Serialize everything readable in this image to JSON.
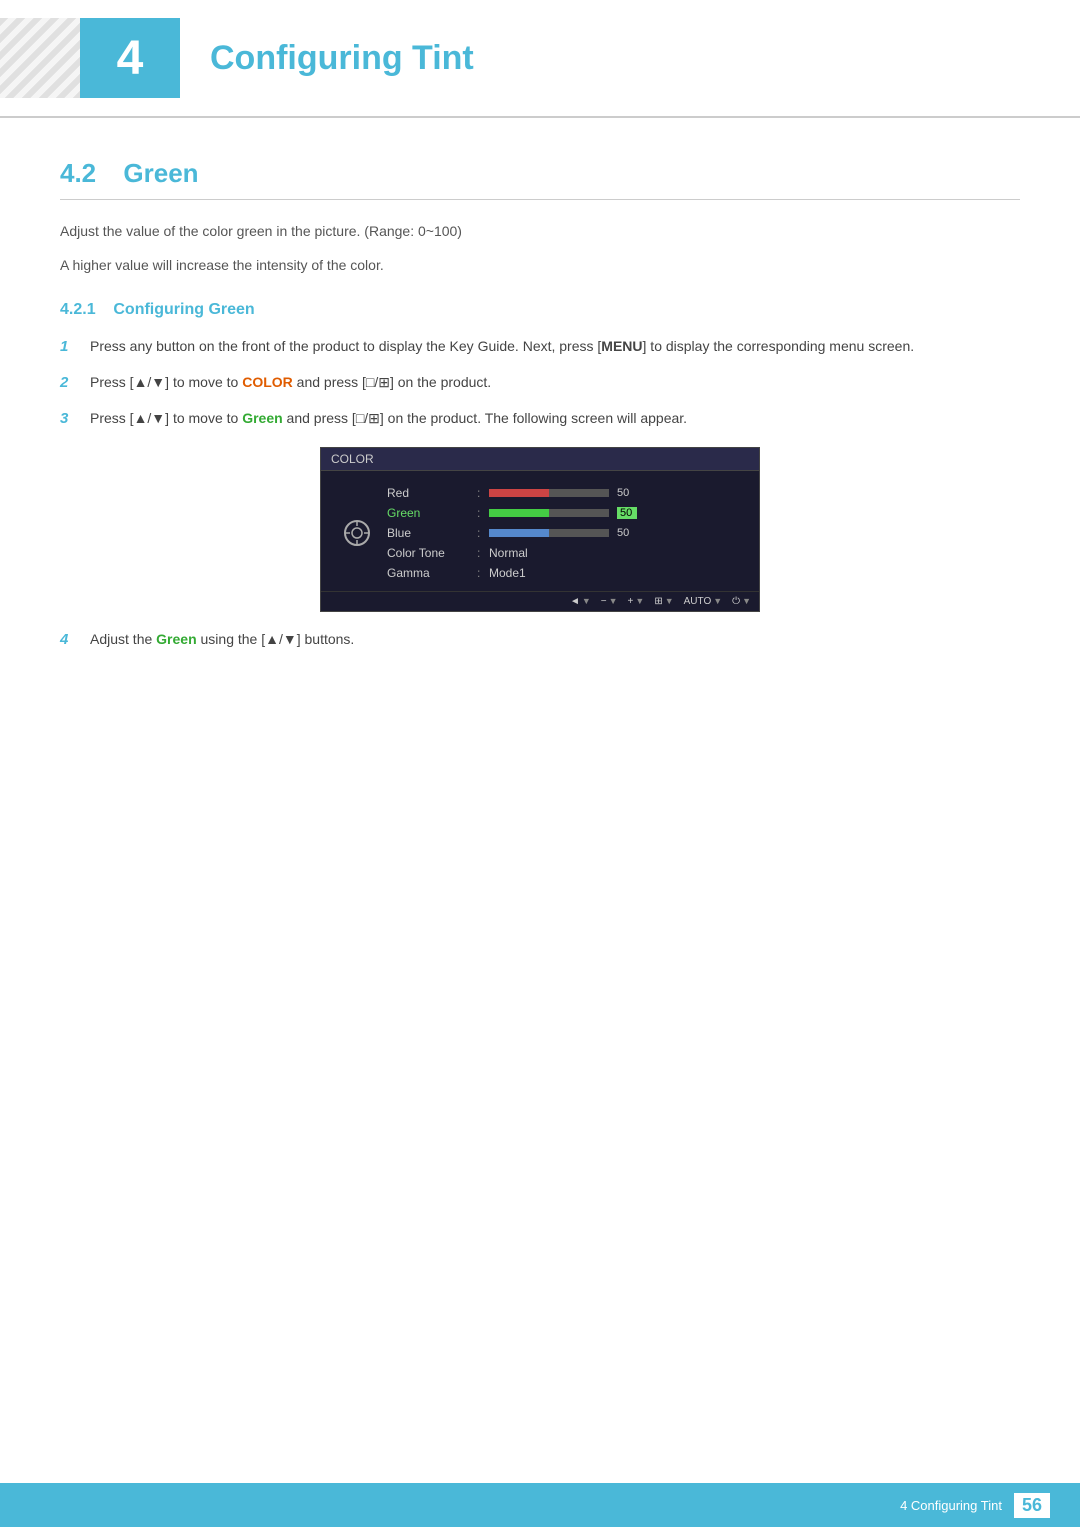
{
  "chapter": {
    "number": "4",
    "title": "Configuring Tint"
  },
  "section42": {
    "heading": "4.2",
    "title": "Green",
    "desc1": "Adjust the value of the color green in the picture. (Range: 0~100)",
    "desc2": "A higher value will increase the intensity of the color."
  },
  "subsection421": {
    "heading": "4.2.1",
    "title": "Configuring Green"
  },
  "steps": [
    {
      "num": "1",
      "text_plain": "Press any button on the front of the product to display the Key Guide. Next, press [",
      "text_bold": "MENU",
      "text_after": "] to display the corresponding menu screen."
    },
    {
      "num": "2",
      "text_pre": "Press [▲/▼] to move to ",
      "highlight1": "COLOR",
      "highlight1_class": "color",
      "text_mid": " and press [□/⊞] on the product."
    },
    {
      "num": "3",
      "text_pre": "Press [▲/▼] to move to ",
      "highlight2": "Green",
      "highlight2_class": "green",
      "text_after": " and press [□/⊞] on the product. The following screen will appear."
    },
    {
      "num": "4",
      "text_pre": "Adjust the ",
      "highlight2": "Green",
      "text_after": " using the [▲/▼] buttons."
    }
  ],
  "monitor": {
    "titlebar": "COLOR",
    "rows": [
      {
        "label": "Red",
        "type": "bar",
        "fill": 50,
        "total": 100,
        "fillColor": "#cc4444",
        "value": "50",
        "selected": false
      },
      {
        "label": "Green",
        "type": "bar",
        "fill": 50,
        "total": 100,
        "fillColor": "#44cc44",
        "value": "50",
        "selected": true
      },
      {
        "label": "Blue",
        "type": "bar",
        "fill": 50,
        "total": 100,
        "fillColor": "#5588cc",
        "value": "50",
        "selected": false
      },
      {
        "label": "Color Tone",
        "type": "text",
        "val": "Normal",
        "selected": false
      },
      {
        "label": "Gamma",
        "type": "text",
        "val": "Mode1",
        "selected": false
      }
    ],
    "bottom_buttons": [
      "◄",
      "−",
      "+",
      "⊞",
      "AUTO",
      "⏻"
    ]
  },
  "footer": {
    "label": "4 Configuring Tint",
    "page": "56"
  }
}
